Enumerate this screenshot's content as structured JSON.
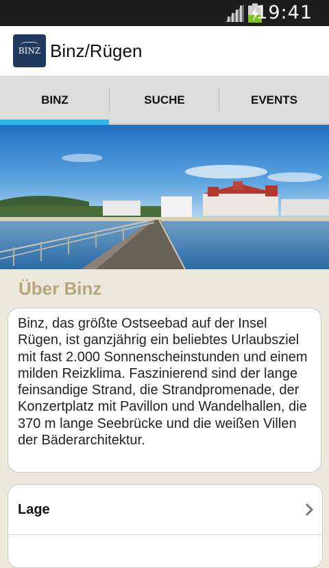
{
  "status_bar": {
    "time": "19:41"
  },
  "app": {
    "title": "Binz/Rügen",
    "logo_text": "BINZ"
  },
  "tabs": [
    {
      "label": "BINZ"
    },
    {
      "label": "SUCHE"
    },
    {
      "label": "EVENTS"
    }
  ],
  "about": {
    "title": "Über Binz",
    "text": "Binz, das größte Ostseebad auf der Insel Rügen, ist ganzjährig ein beliebtes Urlaubsziel mit fast 2.000 Sonnenscheinstunden und einem milden Reizklima. Faszinierend sind der lange feinsandige Strand, die Strandpromenade, der Konzertplatz mit Pavillon und Wandelhallen, die 370 m lange Seebrücke und die weißen Villen der Bäderarchitektur."
  },
  "list": [
    {
      "label": "Lage"
    }
  ]
}
